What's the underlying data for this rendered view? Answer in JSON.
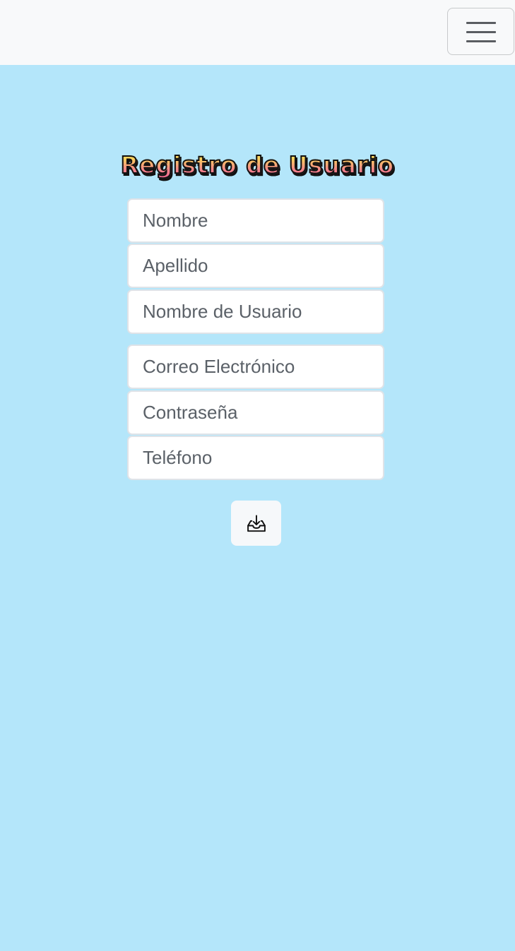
{
  "navbar": {
    "toggle_icon": "hamburger-menu-icon"
  },
  "form": {
    "title": "Registro de Usuario",
    "fields": [
      {
        "name": "nombre",
        "value": "",
        "placeholder": "Nombre"
      },
      {
        "name": "apellido",
        "value": "",
        "placeholder": "Apellido"
      },
      {
        "name": "usuario",
        "value": "",
        "placeholder": "Nombre de Usuario"
      },
      {
        "name": "correo",
        "value": "",
        "placeholder": "Correo Electrónico"
      },
      {
        "name": "contrasena",
        "value": "",
        "placeholder": "Contraseña"
      },
      {
        "name": "telefono",
        "value": "",
        "placeholder": "Teléfono"
      }
    ],
    "submit_icon": "inbox-download-icon"
  },
  "colors": {
    "background": "#b4e6fa",
    "navbar": "#f8f9fa",
    "title_gradient_top": "#fff38a",
    "title_gradient_bottom": "#ec4f93"
  }
}
